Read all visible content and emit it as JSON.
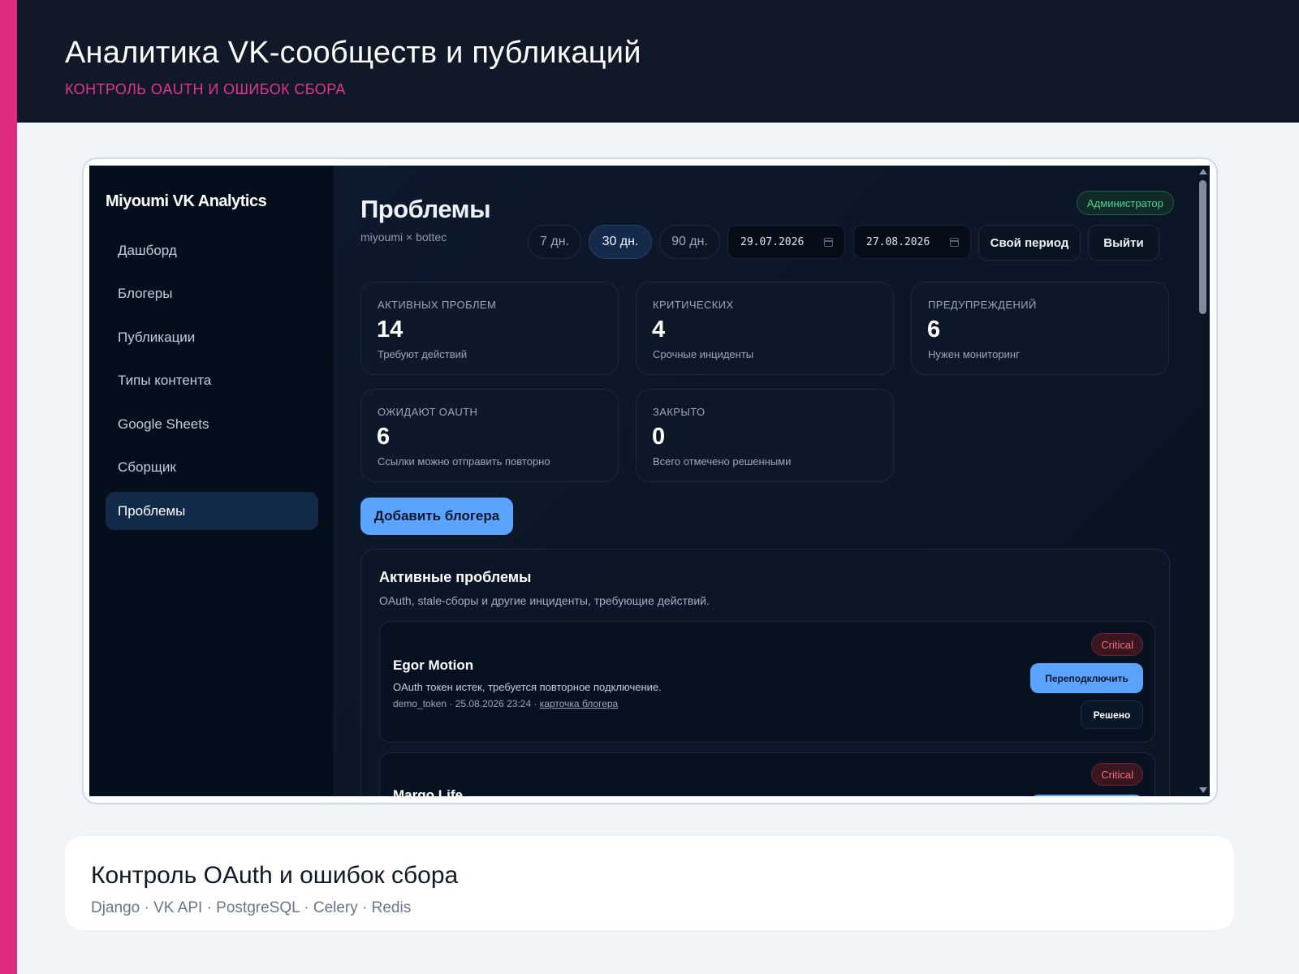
{
  "header": {
    "title": "Аналитика VK-сообществ и публикаций",
    "subtitle": "КОНТРОЛЬ OAUTH И ОШИБОК СБОРА"
  },
  "app": {
    "brand": "Miyoumi VK Analytics",
    "nav": [
      {
        "label": "Дашборд",
        "active": false
      },
      {
        "label": "Блогеры",
        "active": false
      },
      {
        "label": "Публикации",
        "active": false
      },
      {
        "label": "Типы контента",
        "active": false
      },
      {
        "label": "Google Sheets",
        "active": false
      },
      {
        "label": "Сборщик",
        "active": false
      },
      {
        "label": "Проблемы",
        "active": true
      }
    ],
    "page_title": "Проблемы",
    "page_subtitle": "miyoumi × bottec",
    "role_badge": "Администратор",
    "period_buttons": [
      "7 дн.",
      "30 дн.",
      "90 дн."
    ],
    "active_period": "30 дн.",
    "date_from": "29.07.2026",
    "date_to": "27.08.2026",
    "custom_period_label": "Свой период",
    "logout_label": "Выйти",
    "stats": [
      {
        "label": "АКТИВНЫХ ПРОБЛЕМ",
        "value": "14",
        "hint": "Требуют действий"
      },
      {
        "label": "КРИТИЧЕСКИХ",
        "value": "4",
        "hint": "Срочные инциденты"
      },
      {
        "label": "ПРЕДУПРЕЖДЕНИЙ",
        "value": "6",
        "hint": "Нужен мониторинг"
      },
      {
        "label": "ОЖИДАЮТ OAUTH",
        "value": "6",
        "hint": "Ссылки можно отправить повторно"
      },
      {
        "label": "ЗАКРЫТО",
        "value": "0",
        "hint": "Всего отмечено решенными"
      }
    ],
    "add_blogger_label": "Добавить блогера",
    "panel": {
      "title": "Активные проблемы",
      "description": "OAuth, stale-сборы и другие инциденты, требующие действий.",
      "issues": [
        {
          "name": "Egor Motion",
          "severity": "Critical",
          "message": "OAuth токен истек, требуется повторное подключение.",
          "meta": "demo_token · 25.08.2026 23:24 · ",
          "link": "карточка блогера",
          "reconnect_label": "Переподключить",
          "resolved_label": "Решено"
        },
        {
          "name": "Margo Life",
          "severity": "Critical"
        }
      ]
    }
  },
  "caption": {
    "title": "Контроль OAuth и ошибок сбора",
    "stack": "Django · VK API · PostgreSQL · Celery · Redis"
  },
  "colors": {
    "accent": "#de2a80",
    "primary_button": "#5aa3ff",
    "critical": "#f16b7f",
    "admin_badge": "#4fd39a"
  }
}
